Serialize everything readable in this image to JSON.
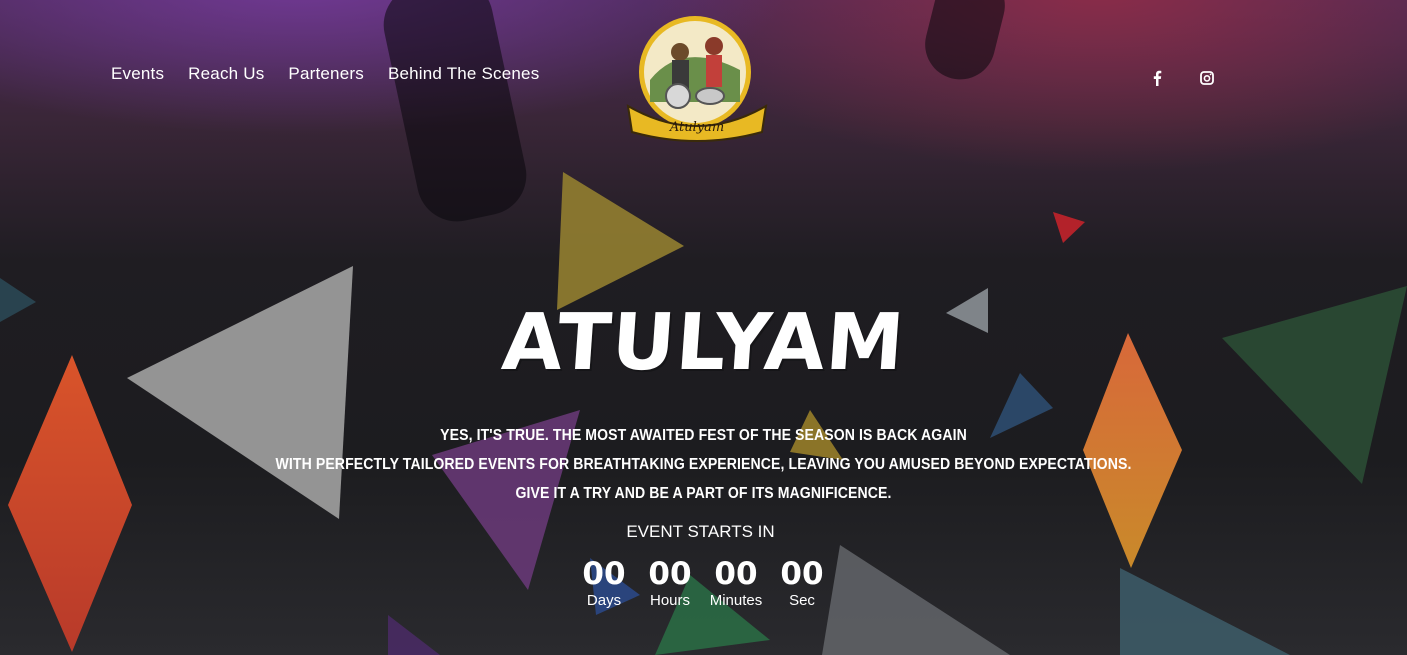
{
  "nav": {
    "items": [
      {
        "label": "Events"
      },
      {
        "label": "Reach Us"
      },
      {
        "label": "Parteners"
      },
      {
        "label": "Behind The Scenes"
      }
    ]
  },
  "logo": {
    "text": "Atulyam",
    "icon": "atulyam-logo"
  },
  "social": [
    {
      "icon": "facebook-icon",
      "glyph": "f"
    },
    {
      "icon": "instagram-icon"
    }
  ],
  "hero": {
    "title": "ATULYAM",
    "tagline": [
      "YES, IT'S TRUE. THE MOST AWAITED FEST OF THE SEASON IS BACK AGAIN",
      "WITH PERFECTLY TAILORED EVENTS FOR BREATHTAKING EXPERIENCE, LEAVING YOU AMUSED BEYOND EXPECTATIONS.",
      "GIVE IT A TRY AND BE A PART OF ITS MAGNIFICENCE."
    ]
  },
  "countdown": {
    "heading": "EVENT STARTS IN",
    "units": [
      {
        "value": "00",
        "label": "Days"
      },
      {
        "value": "00",
        "label": "Hours"
      },
      {
        "value": "00",
        "label": "Minutes"
      },
      {
        "value": "00",
        "label": "Sec"
      }
    ]
  },
  "colors": {
    "background": "#1c1c1f",
    "header_purple": "#4a2a55",
    "header_red": "#962d46",
    "logo_gold": "#e8b923"
  }
}
